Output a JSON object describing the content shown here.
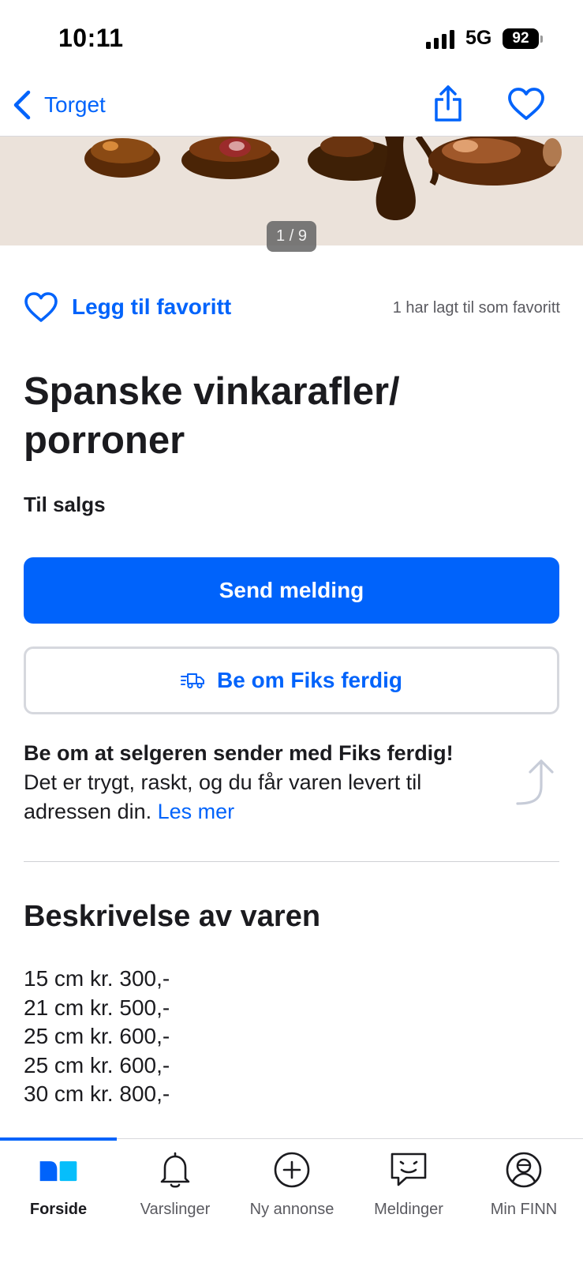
{
  "status_bar": {
    "time": "10:11",
    "network": "5G",
    "battery": "92"
  },
  "nav": {
    "back_label": "Torget"
  },
  "image": {
    "counter": "1 / 9"
  },
  "favorite": {
    "label": "Legg til favoritt",
    "count_text": "1 har lagt til som favoritt"
  },
  "listing": {
    "title": "Spanske vinkarafler/ porroner",
    "status": "Til salgs"
  },
  "actions": {
    "primary_label": "Send melding",
    "secondary_label": "Be om Fiks ferdig"
  },
  "fiks_info": {
    "heading": "Be om at selgeren sender med Fiks ferdig!",
    "body": "Det er trygt, raskt, og du får varen levert til adressen din.",
    "link": "Les mer"
  },
  "description": {
    "title": "Beskrivelse av varen",
    "lines": [
      "15 cm kr. 300,-",
      "21 cm kr. 500,-",
      "25 cm kr. 600,-",
      "25 cm kr. 600,-",
      "30 cm kr. 800,-"
    ]
  },
  "tab_bar": {
    "tabs": [
      {
        "label": "Forside",
        "icon": "home-icon",
        "active": true
      },
      {
        "label": "Varslinger",
        "icon": "bell-icon",
        "active": false
      },
      {
        "label": "Ny annonse",
        "icon": "plus-circle-icon",
        "active": false
      },
      {
        "label": "Meldinger",
        "icon": "chat-icon",
        "active": false
      },
      {
        "label": "Min FINN",
        "icon": "profile-icon",
        "active": false
      }
    ]
  },
  "colors": {
    "accent": "#0063fb",
    "text": "#1b1b1f",
    "muted": "#5a5a60"
  }
}
